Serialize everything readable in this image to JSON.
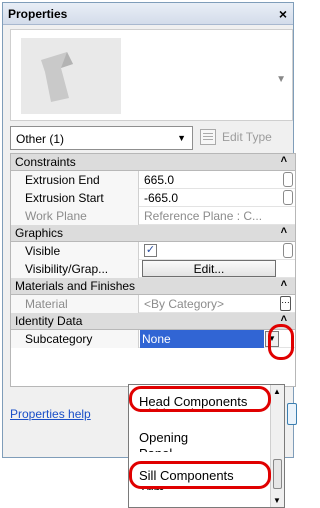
{
  "window": {
    "title": "Properties",
    "close_glyph": "×"
  },
  "type_selector": {
    "value": "Other (1)",
    "edit_type_label": "Edit Type"
  },
  "groups": {
    "constraints": "Constraints",
    "graphics": "Graphics",
    "materials": "Materials and Finishes",
    "identity": "Identity Data"
  },
  "props": {
    "extrusion_end": {
      "name": "Extrusion End",
      "value": "665.0"
    },
    "extrusion_start": {
      "name": "Extrusion Start",
      "value": "-665.0"
    },
    "work_plane": {
      "name": "Work Plane",
      "value": "Reference Plane : C..."
    },
    "visible": {
      "name": "Visible",
      "checked": true
    },
    "visibility": {
      "name": "Visibility/Grap...",
      "button": "Edit..."
    },
    "material": {
      "name": "Material",
      "value": "<By Category>"
    },
    "subcategory": {
      "name": "Subcategory",
      "value": "None"
    }
  },
  "help_link": "Properties help",
  "subcategory_options": {
    "head": "Head Components",
    "hidden": "Hidden Lines",
    "opening": "Opening",
    "panel": "Panel",
    "sill": "Sill Components",
    "trim": "Trim"
  },
  "colors": {
    "highlight": "#3165d4",
    "annotation": "#e00000",
    "link": "#1a4fc8"
  }
}
